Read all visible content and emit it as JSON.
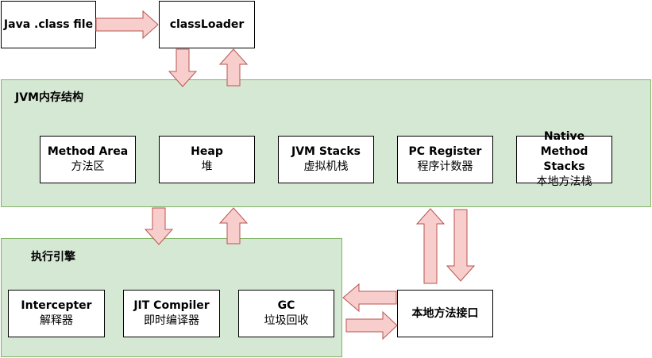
{
  "nodes": {
    "java_class_file": "Java .class file",
    "class_loader": "classLoader",
    "jvm_memory": {
      "title": "JVM内存结构",
      "method_area": {
        "name": "Method Area",
        "cn": "方法区"
      },
      "heap": {
        "name": "Heap",
        "cn": "堆"
      },
      "jvm_stacks": {
        "name": "JVM Stacks",
        "cn": "虚拟机栈"
      },
      "pc_register": {
        "name": "PC Register",
        "cn": "程序计数器"
      },
      "native_method_stacks": {
        "name": "Native Method Stacks",
        "cn": "本地方法栈"
      }
    },
    "execution_engine": {
      "title": "执行引擎",
      "intercepter": {
        "name": "Intercepter",
        "cn": "解释器"
      },
      "jit_compiler": {
        "name": "JIT Compiler",
        "cn": "即时编译器"
      },
      "gc": {
        "name": "GC",
        "cn": "垃圾回收"
      }
    },
    "native_interface": "本地方法接口"
  },
  "colors": {
    "region_fill": "#d5e8d4",
    "region_stroke": "#82b366",
    "arrow_fill": "#f8cecc",
    "arrow_stroke": "#b85450"
  }
}
